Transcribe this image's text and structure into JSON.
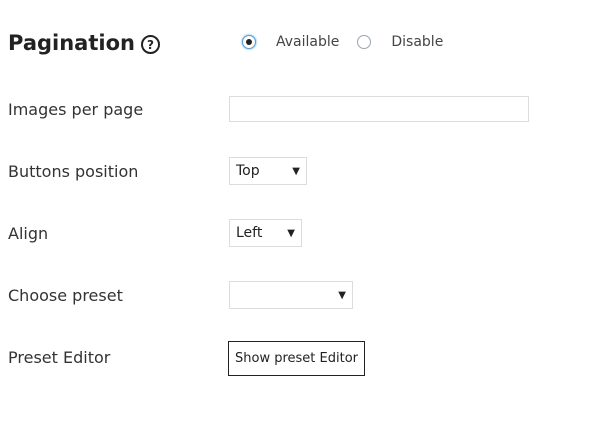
{
  "pagination": {
    "title": "Pagination",
    "help_icon": "question-circle-icon",
    "options": [
      {
        "label": "Available",
        "checked": true
      },
      {
        "label": "Disable",
        "checked": false
      }
    ]
  },
  "fields": {
    "images_per_page": {
      "label": "Images per page",
      "value": ""
    },
    "buttons_position": {
      "label": "Buttons position",
      "selected": "Top"
    },
    "align": {
      "label": "Align",
      "selected": "Left"
    },
    "choose_preset": {
      "label": "Choose preset",
      "selected": ""
    },
    "preset_editor": {
      "label": "Preset Editor",
      "button_label": "Show preset Editor"
    }
  },
  "colors": {
    "focus_ring": "#5b9dd9",
    "input_border": "#dcdcdc"
  }
}
